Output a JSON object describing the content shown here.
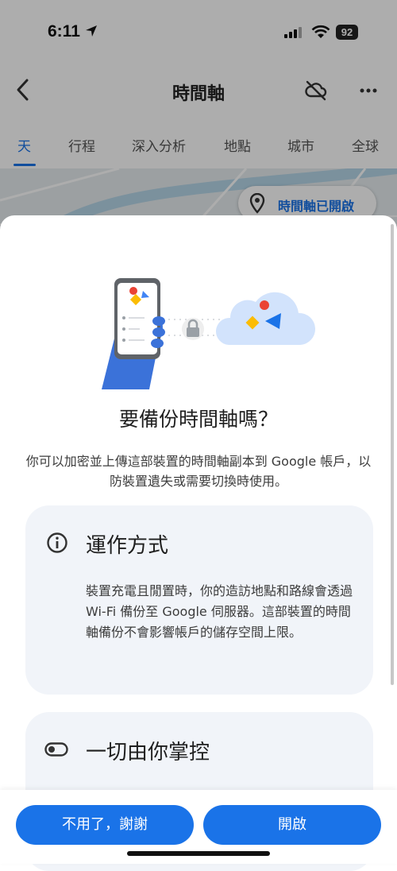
{
  "status": {
    "time": "6:11",
    "battery": "92"
  },
  "appbar": {
    "title": "時間軸"
  },
  "tabs": [
    {
      "label": "天"
    },
    {
      "label": "行程"
    },
    {
      "label": "深入分析"
    },
    {
      "label": "地點"
    },
    {
      "label": "城市"
    },
    {
      "label": "全球"
    }
  ],
  "map": {
    "chip_label": "時間軸已開啟"
  },
  "sheet": {
    "heading": "要備份時間軸嗎？",
    "description": "你可以加密並上傳這部裝置的時間軸副本到 Google 帳戶，以防裝置遺失或需要切換時使用。",
    "cards": [
      {
        "title": "運作方式",
        "icon": "info-icon",
        "body": "裝置充電且閒置時，你的造訪地點和路線會透過 Wi-Fi 備份至 Google 伺服器。這部裝置的時間軸備份不會影響帳戶的儲存空間上限。"
      },
      {
        "title": "一切由你掌控",
        "icon": "toggle-icon",
        "body": ""
      }
    ]
  },
  "buttons": {
    "decline": "不用了，謝謝",
    "accept": "開啟"
  },
  "colors": {
    "accent": "#1a73e8",
    "card": "#f1f4f9"
  }
}
